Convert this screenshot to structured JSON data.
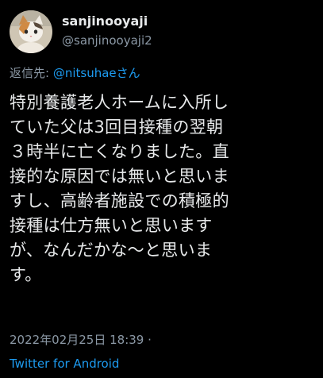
{
  "author": {
    "display_name": "sanjinooyaji",
    "handle": "@sanjinooyaji2",
    "avatar_icon": "calico-kitten-avatar"
  },
  "reply": {
    "prefix": "返信先: ",
    "mention": "@nitsuhaeさん"
  },
  "tweet": {
    "lines": [
      "特別養護老人ホームに入所し",
      "ていた父は3回目接種の翌朝",
      "３時半に亡くなりました。直",
      "接的な原因では無いと思いま",
      "すし、高齢者施設での積極的",
      "接種は仕方無いと思います",
      "が、なんだかな〜と思いま",
      "す。"
    ]
  },
  "meta": {
    "timestamp": "2022年02月25日 18:39 ·",
    "source": "Twitter for Android"
  },
  "colors": {
    "background": "#000000",
    "text": "#e7e9ea",
    "secondary": "#8b98a5",
    "link": "#1d9bf0"
  }
}
